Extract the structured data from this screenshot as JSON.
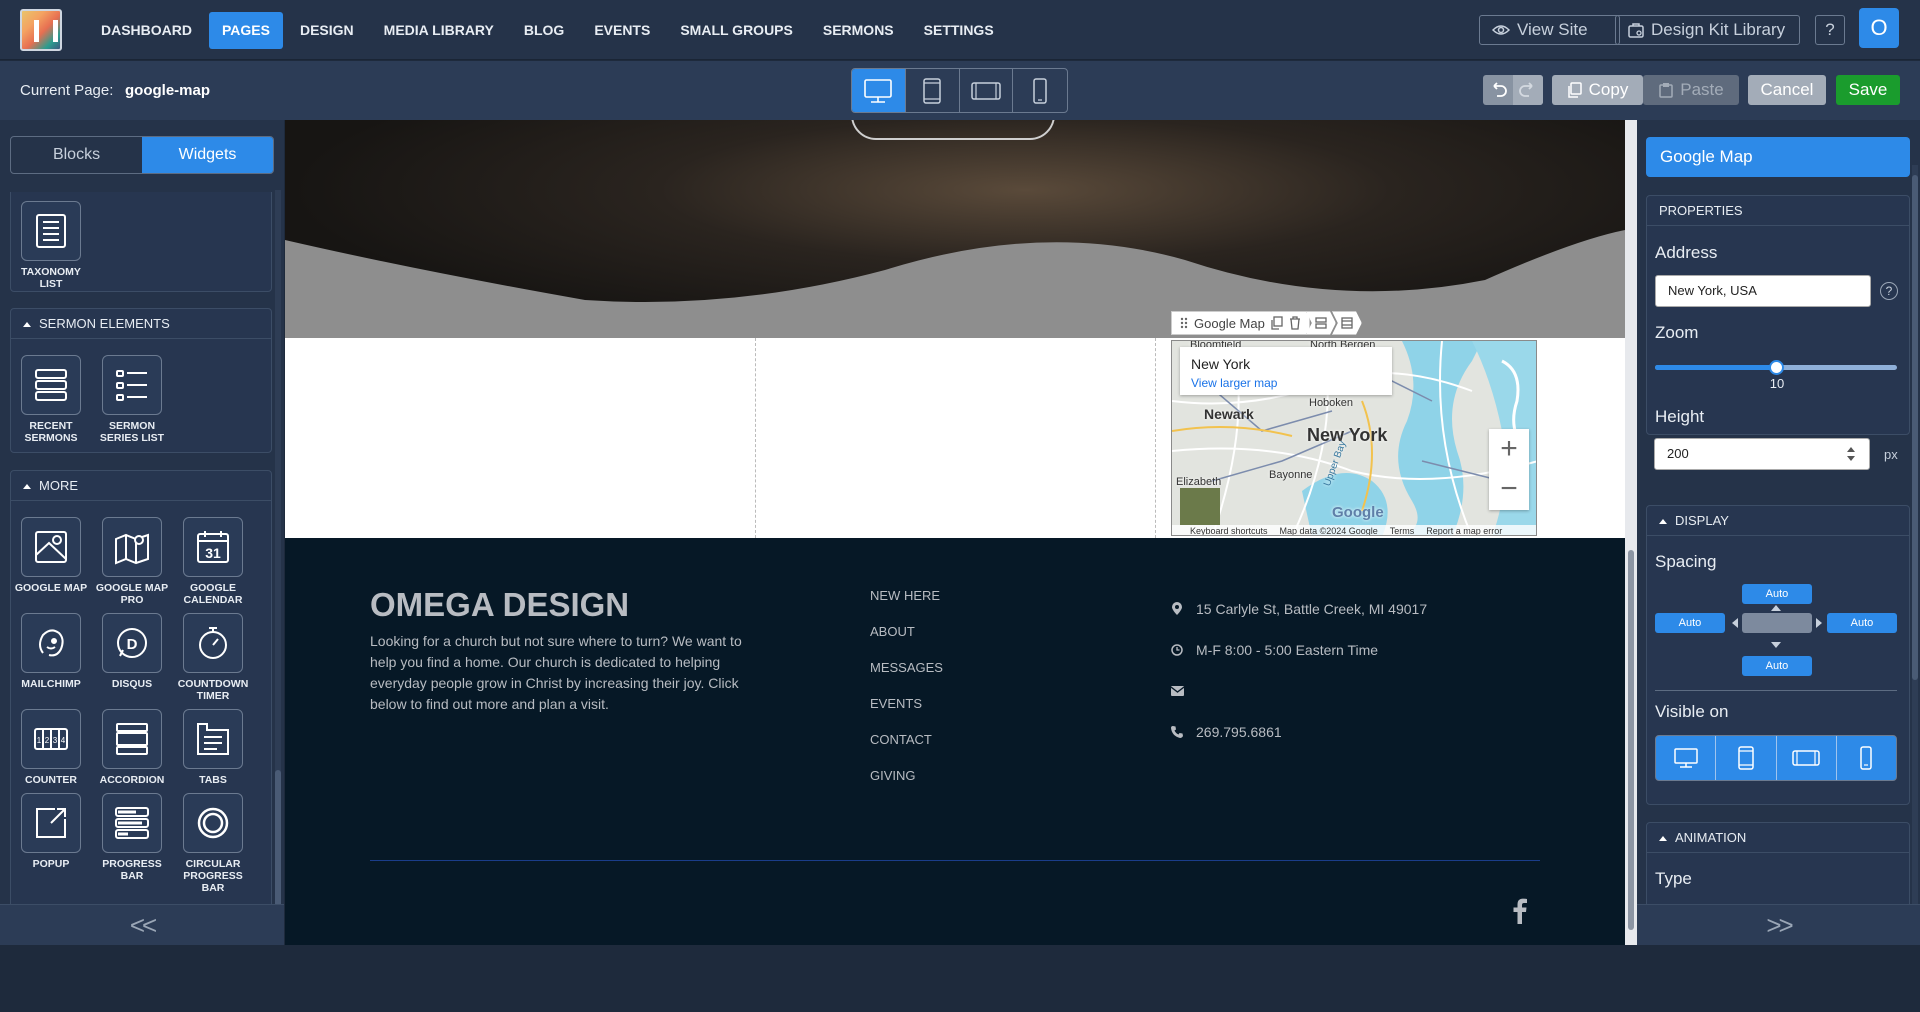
{
  "nav": {
    "items": [
      "DASHBOARD",
      "PAGES",
      "DESIGN",
      "MEDIA LIBRARY",
      "BLOG",
      "EVENTS",
      "SMALL GROUPS",
      "SERMONS",
      "SETTINGS"
    ],
    "active": "PAGES",
    "view_site": "View Site",
    "design_kit": "Design Kit Library",
    "help": "?",
    "avatar": "O"
  },
  "toolbar": {
    "current_page_label": "Current Page:",
    "current_page_value": "google-map",
    "copy_label": "Copy",
    "paste_label": "Paste",
    "cancel_label": "Cancel",
    "save_label": "Save"
  },
  "left_panel": {
    "tabs": [
      "Blocks",
      "Widgets"
    ],
    "active_tab": "Widgets",
    "top_widget": "TAXONOMY LIST",
    "sections": [
      {
        "title": "SERMON ELEMENTS",
        "widgets": [
          "RECENT SERMONS",
          "SERMON SERIES LIST"
        ]
      },
      {
        "title": "MORE",
        "widgets": [
          "GOOGLE MAP",
          "GOOGLE MAP PRO",
          "GOOGLE CALENDAR",
          "MAILCHIMP",
          "DISQUS",
          "COUNTDOWN TIMER",
          "COUNTER",
          "ACCORDION",
          "TABS",
          "POPUP",
          "PROGRESS BAR",
          "CIRCULAR PROGRESS BAR"
        ]
      }
    ],
    "collapse": "<<"
  },
  "map": {
    "place": "New York",
    "larger_map": "View larger map",
    "labels": {
      "bloomfield": "Bloomfield",
      "north_bergen": "North Bergen",
      "hoboken": "Hoboken",
      "newark": "Newark",
      "city": "New York",
      "bayonne": "Bayonne",
      "elizabeth": "Elizabeth",
      "upper_bay": "Upper Bay",
      "google": "Google"
    },
    "footer": [
      "Keyboard shortcuts",
      "Map data ©2024 Google",
      "Terms",
      "Report a map error"
    ],
    "zoom_in": "+",
    "zoom_out": "−"
  },
  "widget_toolbar": {
    "name": "Google Map"
  },
  "footer": {
    "title": "OMEGA DESIGN",
    "text": "Looking for a church but not sure where to turn? We want to help you find a home. Our church is dedicated to helping everyday people grow in Christ by increasing their joy.  Click below to find out more and plan a visit.",
    "links": [
      "NEW HERE",
      "ABOUT",
      "MESSAGES",
      "EVENTS",
      "CONTACT",
      "GIVING"
    ],
    "address": "15 Carlyle St, Battle Creek, MI 49017",
    "hours": "M-F 8:00 - 5:00 Eastern Time",
    "email": "",
    "phone": "269.795.6861"
  },
  "right_panel": {
    "title": "Google Map",
    "properties_label": "PROPERTIES",
    "address_label": "Address",
    "address_value": "New York, USA",
    "help": "?",
    "zoom_label": "Zoom",
    "zoom_value": "10",
    "height_label": "Height",
    "height_value": "200",
    "height_unit": "px",
    "display_label": "DISPLAY",
    "spacing_label": "Spacing",
    "spacing": {
      "top": "Auto",
      "left": "Auto",
      "right": "Auto",
      "bottom": "Auto"
    },
    "visible_label": "Visible on",
    "animation_label": "ANIMATION",
    "type_label": "Type",
    "expand": ">>"
  },
  "colors": {
    "accent": "#2d8ae8",
    "save": "#1a9c2d",
    "footer_bg": "#061826"
  }
}
